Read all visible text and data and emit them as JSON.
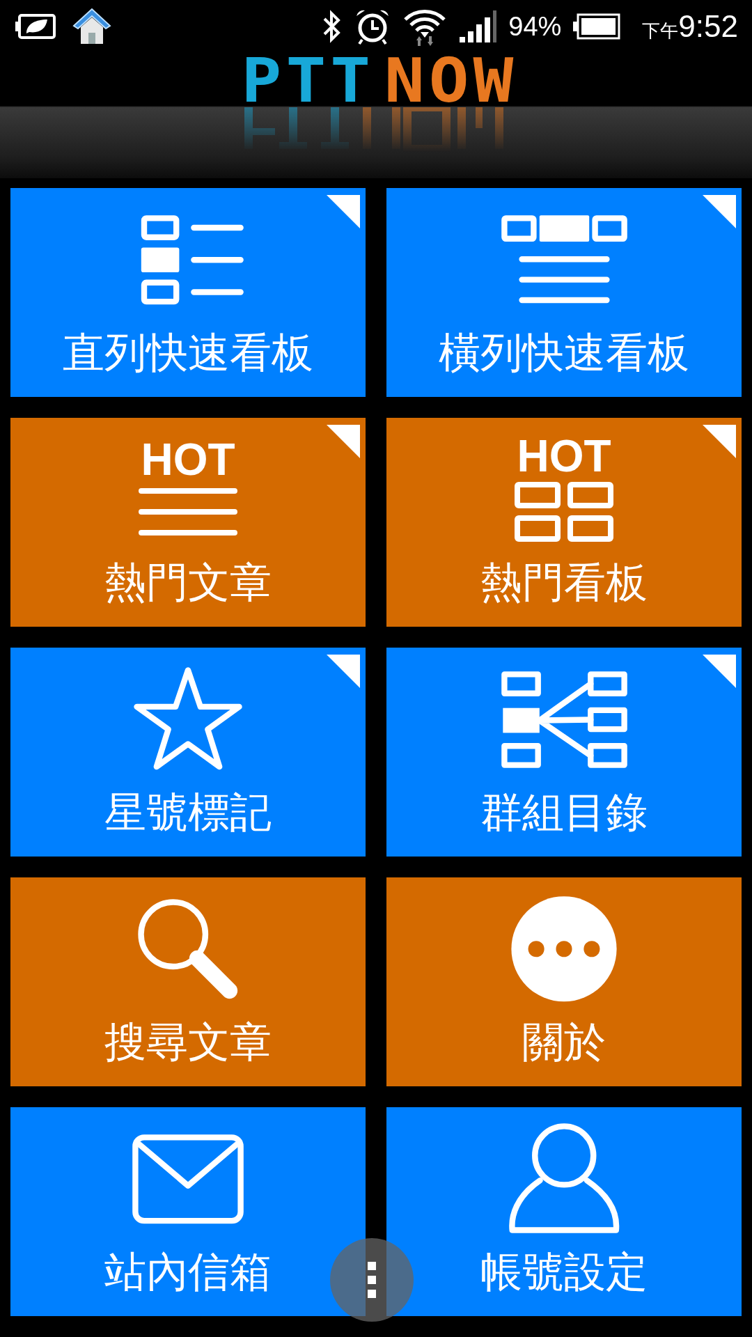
{
  "status_bar": {
    "battery_percent": "94%",
    "time_period": "下午",
    "time": "9:52"
  },
  "header": {
    "logo_left": "PTT",
    "logo_right": "NOW"
  },
  "tiles": [
    {
      "label": "直列快速看板",
      "color": "#0080ff",
      "corner_mark": true
    },
    {
      "label": "橫列快速看板",
      "color": "#0080ff",
      "corner_mark": true
    },
    {
      "label": "熱門文章",
      "color": "#d46a00",
      "corner_mark": true,
      "badge": "HOT"
    },
    {
      "label": "熱門看板",
      "color": "#d46a00",
      "corner_mark": true,
      "badge": "HOT"
    },
    {
      "label": "星號標記",
      "color": "#0080ff",
      "corner_mark": true
    },
    {
      "label": "群組目錄",
      "color": "#0080ff",
      "corner_mark": true
    },
    {
      "label": "搜尋文章",
      "color": "#d46a00",
      "corner_mark": false
    },
    {
      "label": "關於",
      "color": "#d46a00",
      "corner_mark": false
    },
    {
      "label": "站內信箱",
      "color": "#0080ff",
      "corner_mark": false
    },
    {
      "label": "帳號設定",
      "color": "#0080ff",
      "corner_mark": false
    }
  ]
}
